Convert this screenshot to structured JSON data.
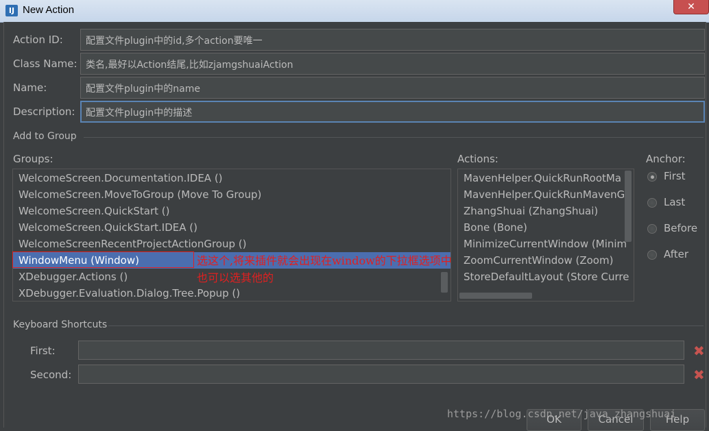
{
  "window": {
    "title": "New Action",
    "icon": "intellij-icon",
    "icon_text": "IJ",
    "close_label": "✕"
  },
  "form": {
    "action_id": {
      "label": "Action ID:",
      "value": "配置文件plugin中的id,多个action要唯一"
    },
    "class_name": {
      "label": "Class Name:",
      "value": "类名,最好以Action结尾,比如zjamgshuaiAction"
    },
    "name": {
      "label": "Name:",
      "value": "配置文件plugin中的name"
    },
    "description": {
      "label": "Description:",
      "value": "配置文件plugin中的描述"
    }
  },
  "add_to_group": {
    "title": "Add to Group",
    "groups_label": "Groups:",
    "groups": [
      "WelcomeScreen.Documentation.IDEA ()",
      "WelcomeScreen.MoveToGroup (Move To Group)",
      "WelcomeScreen.QuickStart ()",
      "WelcomeScreen.QuickStart.IDEA ()",
      "WelcomeScreenRecentProjectActionGroup ()",
      "WindowMenu (Window)",
      "XDebugger.Actions ()",
      "XDebugger.Evaluation.Dialog.Tree.Popup ()"
    ],
    "selected_group_index": 5,
    "actions_label": "Actions:",
    "actions": [
      "MavenHelper.QuickRunRootMa",
      "MavenHelper.QuickRunMavenG",
      "ZhangShuai (ZhangShuai)",
      "Bone (Bone)",
      "MinimizeCurrentWindow (Minim",
      "ZoomCurrentWindow (Zoom)",
      "StoreDefaultLayout (Store Curre"
    ],
    "anchor_label": "Anchor:",
    "anchors": [
      "First",
      "Last",
      "Before",
      "After"
    ],
    "selected_anchor": "First"
  },
  "annotation": {
    "line1": "选这个,将来插件就会出现在window的下拉框选项中",
    "line2": "也可以选其他的",
    "color": "#e02020"
  },
  "shortcuts": {
    "title": "Keyboard Shortcuts",
    "first_label": "First:",
    "second_label": "Second:",
    "first_value": "",
    "second_value": "",
    "clear_icon": "✖"
  },
  "buttons": {
    "ok": "OK",
    "cancel": "Cancel",
    "help": "Help"
  },
  "watermark": "https://blog.csdn.net/java_zhangshuai",
  "colors": {
    "background": "#3c3f41",
    "selection": "#4b6eaf",
    "focus_border": "#5b84b4",
    "clear_icon": "#c75450"
  }
}
